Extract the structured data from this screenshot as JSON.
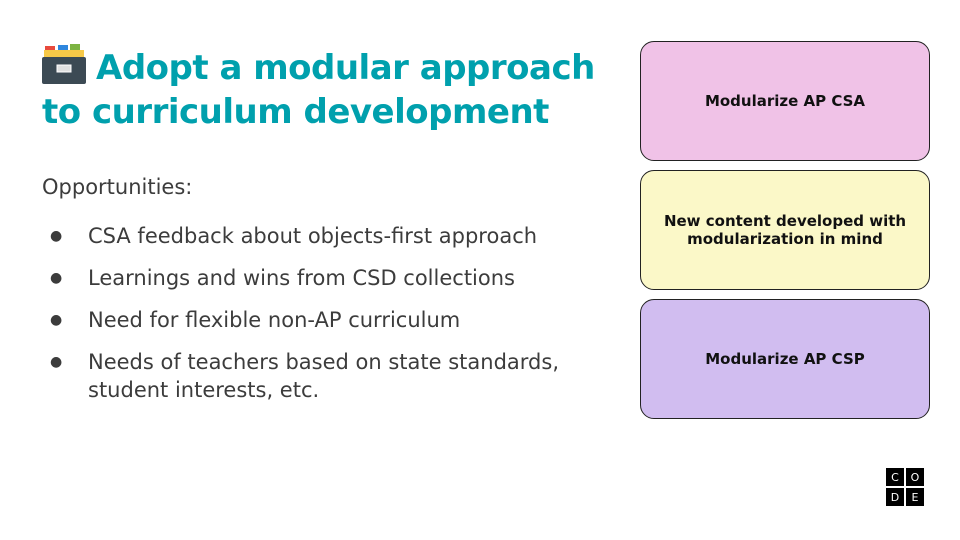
{
  "title": "Adopt a modular approach to curriculum development",
  "subtitle": "Opportunities:",
  "bullets": [
    "CSA feedback about objects-first approach",
    "Learnings and wins from CSD collections",
    "Need for flexible non-AP curriculum",
    "Needs of teachers based on state standards, student interests, etc."
  ],
  "boxes": [
    {
      "label": "Modularize AP CSA",
      "color": "#f0c2e7"
    },
    {
      "label": "New content developed with modularization in mind",
      "color": "#fbf8c8"
    },
    {
      "label": "Modularize AP CSP",
      "color": "#d1bdf0"
    }
  ],
  "logo": [
    "C",
    "O",
    "D",
    "E"
  ]
}
